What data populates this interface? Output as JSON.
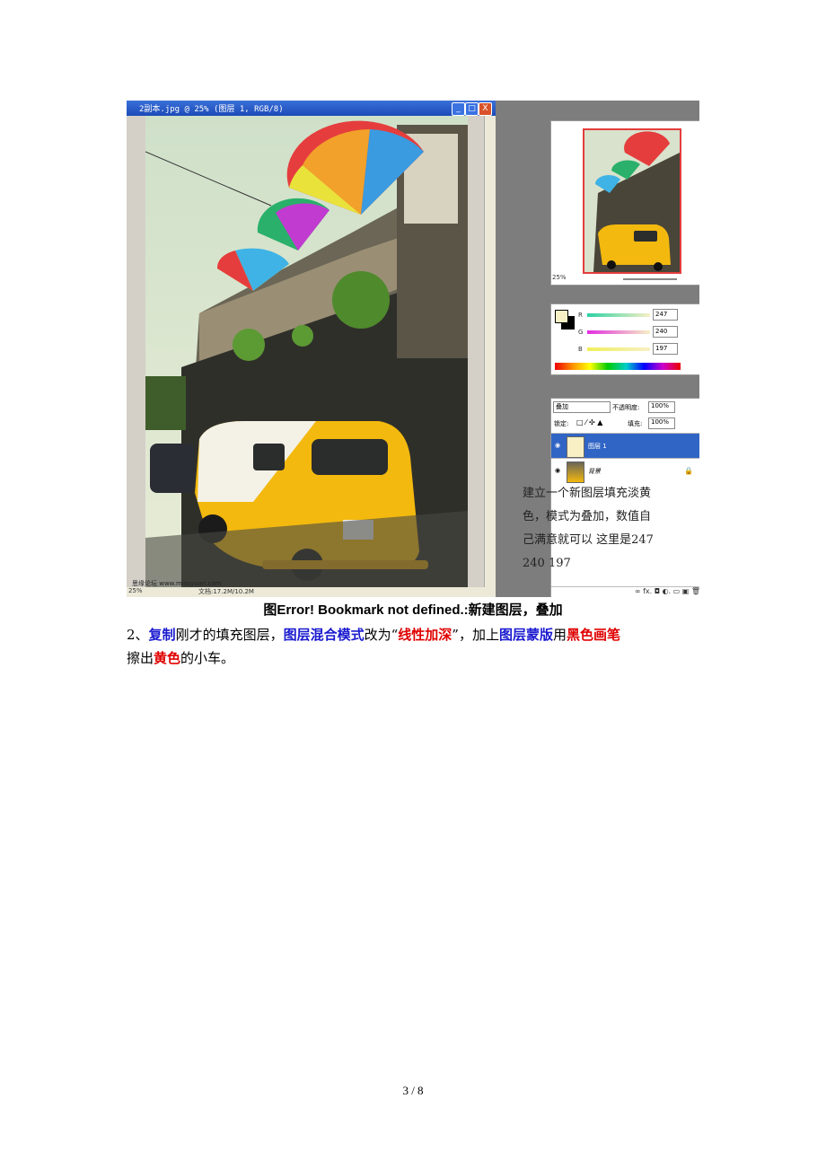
{
  "figure": {
    "window_title": "2副本.jpg @ 25% (图层 1, RGB/8)",
    "window_buttons": [
      "_",
      "□",
      "X"
    ],
    "status_left": "25%",
    "status_doc": "文档:17.2M/10.2M",
    "watermark": "思缘论坛 www.missyuan.com",
    "navigator_zoom": "25%",
    "color": {
      "r_label": "R",
      "r_value": "247",
      "g_label": "G",
      "g_value": "240",
      "b_label": "B",
      "b_value": "197",
      "fg_color": "#f7f0c5",
      "bg_color": "#000000"
    },
    "layers": {
      "blend_mode": "叠加",
      "opacity_label": "不透明度:",
      "opacity_value": "100%",
      "lock_label": "锁定:",
      "fill_label": "填充:",
      "fill_value": "100%",
      "items": [
        {
          "name": "图层 1",
          "selected": true
        },
        {
          "name": "背景",
          "selected": false
        }
      ],
      "bottom_icons": "∞ fx. ◘ ◐. ▭ ▣ 🗑"
    },
    "note_lines": [
      "建立一个新图层填充淡黄",
      "色，模式为叠加，数值自",
      "己满意就可以 这里是247",
      "240 197"
    ]
  },
  "caption": "图Error! Bookmark not defined.:新建图层，叠加",
  "paragraph": {
    "p1": "2、",
    "k1": "复制",
    "p2": "刚才的填充图层，",
    "k2": "图层混合模式",
    "p3": "改为“",
    "k3": "线性加深",
    "p4": "”，加上",
    "k4": "图层蒙版",
    "p5": "用",
    "k5": "黑色画笔",
    "p6": "擦出",
    "k6": "黄色",
    "p7": "的小车。"
  },
  "page_number": "3 / 8"
}
